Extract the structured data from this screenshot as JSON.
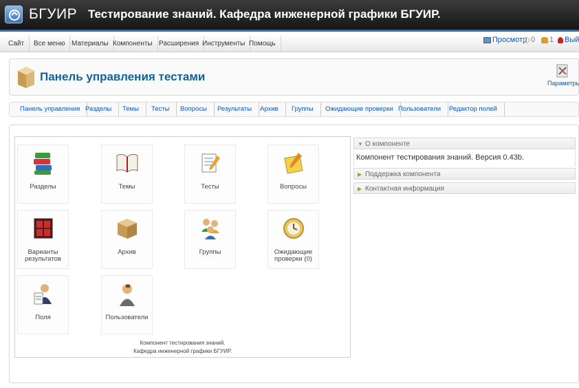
{
  "header": {
    "brand": "БГУИР",
    "title": "Тестирование знаний. Кафедра инженерной графики БГУИР."
  },
  "menu": {
    "items": [
      "Сайт",
      "Все меню",
      "Материалы",
      "Компоненты",
      "Расширения",
      "Инструменты",
      "Помощь"
    ]
  },
  "status": {
    "preview": "Просмотр",
    "messages": "0",
    "users": "1",
    "logout": "Выйти"
  },
  "toolbar": {
    "title": "Панель управления тестами",
    "params_label": "Параметры"
  },
  "subnav": {
    "items": [
      "Панель управления",
      "Разделы",
      "Темы",
      "Тесты",
      "Вопросы",
      "Результаты",
      "Архив",
      "Группы",
      "Ожидающие проверки",
      "Пользователи",
      "Редактор полей"
    ]
  },
  "cpanel": {
    "tiles": [
      {
        "label": "Разделы",
        "icon": "books-icon"
      },
      {
        "label": "Темы",
        "icon": "open-book-icon"
      },
      {
        "label": "Тесты",
        "icon": "notepad-pencil-icon"
      },
      {
        "label": "Вопросы",
        "icon": "yellow-notepad-icon"
      },
      {
        "label": "Варианты результатов",
        "icon": "red-board-icon"
      },
      {
        "label": "Архив",
        "icon": "cardboard-box-icon"
      },
      {
        "label": "Группы",
        "icon": "group-people-icon"
      },
      {
        "label": "Ожидающие проверки (0)",
        "icon": "clock-icon"
      },
      {
        "label": "Поля",
        "icon": "user-form-icon"
      },
      {
        "label": "Пользователи",
        "icon": "user-icon"
      }
    ],
    "footer_line1": "Компонент тестирования знаний.",
    "footer_line2": "Кафедра инженерной графики БГУИР."
  },
  "accordion": {
    "about_title": "О компоненте",
    "about_text": "Компонент тестирования знаний. Версия 0.43b.",
    "support_title": "Поддержка компонента",
    "contact_title": "Контактная информация"
  },
  "colors": {
    "link": "#0b55c4",
    "title": "#146295",
    "header_stripe": "#2d6bb3"
  }
}
